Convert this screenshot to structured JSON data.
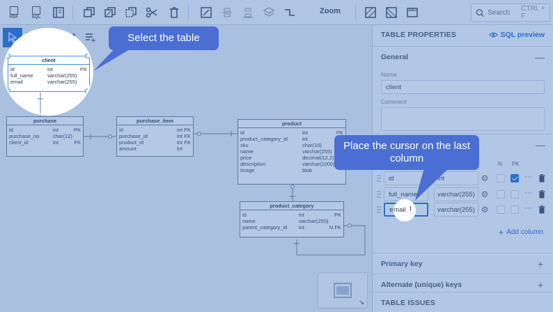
{
  "toolbar": {
    "pdf_label": "PDF",
    "sql_label": "SQL",
    "zoom_label": "Zoom",
    "search_placeholder": "Search",
    "search_shortcut": "CTRL + F"
  },
  "diagram": {
    "client": {
      "title": "client",
      "rows": [
        {
          "name": "id",
          "type": "int",
          "key": "PK"
        },
        {
          "name": "full_name",
          "type": "varchar(255)",
          "key": ""
        },
        {
          "name": "email",
          "type": "varchar(255)",
          "key": ""
        }
      ]
    },
    "purchase": {
      "title": "purchase",
      "rows": [
        {
          "name": "id",
          "type": "int",
          "key": "PK"
        },
        {
          "name": "purchase_no",
          "type": "char(12)",
          "key": ""
        },
        {
          "name": "client_id",
          "type": "int",
          "key": "FK"
        }
      ]
    },
    "purchase_item": {
      "title": "purchase_item",
      "rows": [
        {
          "name": "id",
          "type": "int",
          "key": "PK"
        },
        {
          "name": "purchase_id",
          "type": "int",
          "key": "FK"
        },
        {
          "name": "product_id",
          "type": "int",
          "key": "FK"
        },
        {
          "name": "amount",
          "type": "int",
          "key": ""
        }
      ]
    },
    "product": {
      "title": "product",
      "rows": [
        {
          "name": "id",
          "type": "int",
          "key": "PK"
        },
        {
          "name": "product_category_id",
          "type": "int",
          "key": ""
        },
        {
          "name": "sku",
          "type": "char(10)",
          "key": ""
        },
        {
          "name": "name",
          "type": "varchar(255)",
          "key": ""
        },
        {
          "name": "price",
          "type": "decimal(12,2)",
          "key": ""
        },
        {
          "name": "description",
          "type": "varchar(1000)",
          "key": ""
        },
        {
          "name": "image",
          "type": "blob",
          "key": ""
        }
      ]
    },
    "product_category": {
      "title": "product_category",
      "rows": [
        {
          "name": "id",
          "type": "int",
          "key": "PK"
        },
        {
          "name": "name",
          "type": "varchar(255)",
          "key": ""
        },
        {
          "name": "parent_category_id",
          "type": "int",
          "key": "N FK"
        }
      ]
    }
  },
  "panel": {
    "title": "TABLE PROPERTIES",
    "sql_preview": "SQL preview",
    "general": "General",
    "name_label": "Name",
    "name_value": "client",
    "comment_label": "Comment",
    "col_n": "N",
    "col_pk": "PK",
    "columns": [
      {
        "name": "id",
        "type": "int",
        "nullable": false,
        "pk": true
      },
      {
        "name": "full_name",
        "type": "varchar(255)",
        "nullable": false,
        "pk": false
      },
      {
        "name": "email",
        "type": "varchar(255)",
        "nullable": false,
        "pk": false
      }
    ],
    "add_column": "Add column",
    "primary_key": "Primary key",
    "alternate_keys": "Alternate (unique) keys",
    "table_issues": "TABLE ISSUES"
  },
  "tutorial": {
    "callout_1": "Select the table",
    "callout_2": "Place the cursor on the last column"
  },
  "colors": {
    "accent": "#1f6fd6",
    "callout": "#4a6ed3",
    "overlay": "#3c6ebe"
  }
}
